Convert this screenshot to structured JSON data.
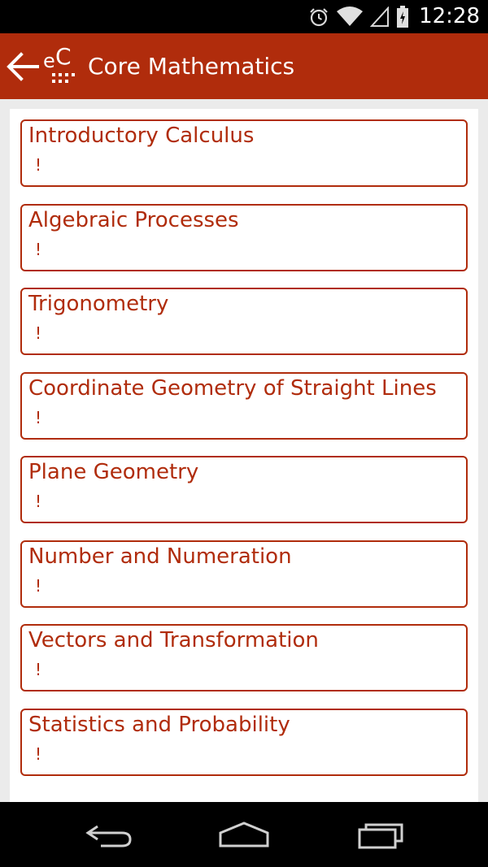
{
  "status_bar": {
    "time": "12:28",
    "icons": [
      "alarm-icon",
      "wifi-icon",
      "signal-icon",
      "battery-icon"
    ]
  },
  "app_bar": {
    "title": "Core Mathematics",
    "logo_text": "eC",
    "color": "#b02c0c"
  },
  "topics": [
    {
      "title": "Introductory Calculus",
      "sub": "!"
    },
    {
      "title": "Algebraic Processes",
      "sub": "!"
    },
    {
      "title": "Trigonometry",
      "sub": "!"
    },
    {
      "title": "Coordinate Geometry of Straight Lines",
      "sub": "!"
    },
    {
      "title": "Plane Geometry",
      "sub": "!"
    },
    {
      "title": "Number and Numeration",
      "sub": "!"
    },
    {
      "title": "Vectors and Transformation",
      "sub": "!"
    },
    {
      "title": "Statistics and Probability",
      "sub": "!"
    }
  ],
  "nav_bar": {
    "buttons": [
      "back-nav-icon",
      "home-nav-icon",
      "recents-nav-icon"
    ]
  }
}
